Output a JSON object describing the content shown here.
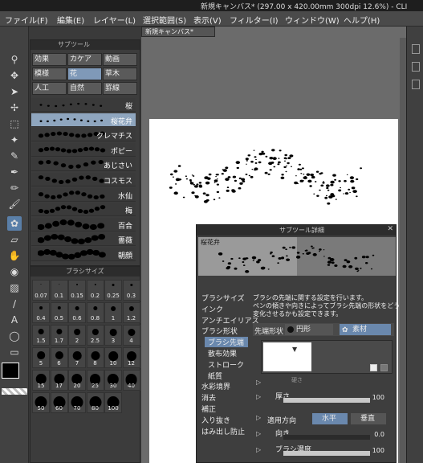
{
  "window": {
    "title": "新規キャンバス* (297.00 x 420.00mm 300dpi 12.6%) - CLI",
    "title_right": "CL"
  },
  "menu": [
    "ファイル(F)",
    "編集(E)",
    "レイヤー(L)",
    "選択範囲(S)",
    "表示(V)",
    "フィルター(I)",
    "ウィンドウ(W)",
    "ヘルプ(H)"
  ],
  "doc_tab": "新規キャンバス*",
  "subtool_panel": {
    "title": "サブツール",
    "groups": [
      "効果",
      "カケア",
      "動画",
      "模様",
      "花",
      "草木",
      "人工",
      "自然",
      "罫線"
    ],
    "brushes": [
      "桜",
      "桜花弁",
      "クレマチス",
      "ポピー",
      "あじさい",
      "コスモス",
      "水仙",
      "梅",
      "百合",
      "薔薇",
      "朝顔"
    ],
    "selected_brush": "桜花弁"
  },
  "brush_size_panel": {
    "title": "ブラシサイズ",
    "sizes": [
      "0.07",
      "0.1",
      "0.15",
      "0.2",
      "0.25",
      "0.3",
      "0.4",
      "0.5",
      "0.6",
      "0.8",
      "1",
      "1.2",
      "1.5",
      "1.7",
      "2",
      "2.5",
      "3",
      "4",
      "5",
      "6",
      "7",
      "8",
      "10",
      "12",
      "15",
      "17",
      "20",
      "25",
      "30",
      "40",
      "50",
      "60",
      "70",
      "80",
      "100"
    ]
  },
  "subtool_detail": {
    "title": "サブツール詳細",
    "preview_label": "桜花弁",
    "categories": [
      "ブラシサイズ",
      "インク",
      "アンチエイリアス",
      "ブラシ形状",
      "ブラシ先端",
      "散布効果",
      "ストローク",
      "紙質",
      "水彩境界",
      "消去",
      "補正",
      "入り抜き",
      "はみ出し防止"
    ],
    "selected_category": "ブラシ先端",
    "description": [
      "ブラシの先端に関する設定を行います。",
      "ペンの傾きや向きによってブラシ先端の形状をどう",
      "変化させるかも設定できます。"
    ],
    "tip_shape_label": "先端形状",
    "tip_option_circle": "円形",
    "tip_option_material": "素材",
    "params": {
      "hardness_label": "硬さ",
      "thickness_label": "厚さ",
      "thickness_value": "100",
      "apply_direction_label": "適用方向",
      "horizontal": "水平",
      "vertical": "垂直",
      "direction_label": "向き",
      "direction_value": "0.0",
      "density_label": "ブラシ濃度",
      "density_value": "100"
    }
  }
}
